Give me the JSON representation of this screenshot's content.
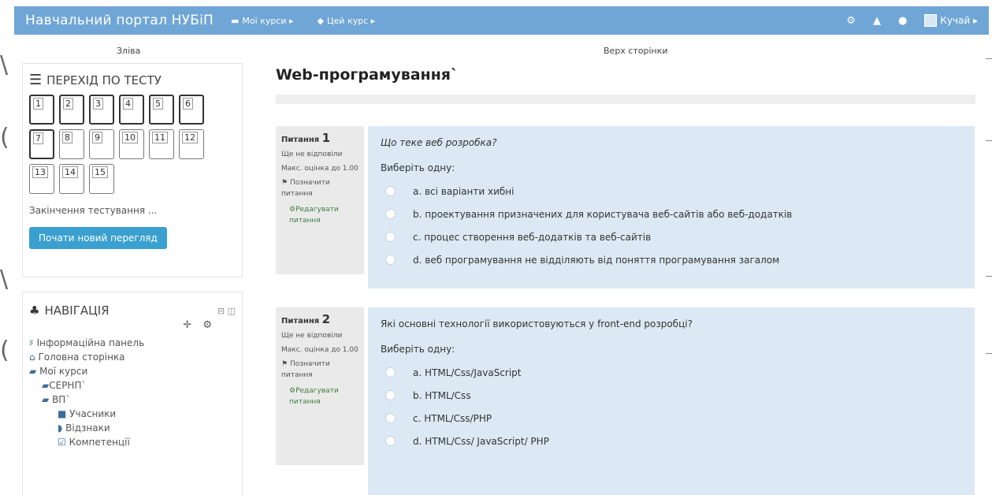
{
  "navbar": {
    "brand": "Навчальний портал НУБіП",
    "menu": [
      {
        "icon": "briefcase-icon",
        "label": "Мої курси ▸"
      },
      {
        "icon": "graduation-cap-icon",
        "label": "Цей курс ▸"
      }
    ],
    "user": "Кучай ▸"
  },
  "regions": {
    "left": "Зліва",
    "top": "Верх сторінки"
  },
  "quiz_nav": {
    "title": "ПЕРЕХІД ПО ТЕСТУ",
    "buttons": [
      "1",
      "2",
      "3",
      "4",
      "5",
      "6",
      "7",
      "8",
      "9",
      "10",
      "11",
      "12",
      "13",
      "14",
      "15"
    ],
    "finish": "Закінчення тестування ...",
    "restart": "Почати новий перегляд"
  },
  "navigation": {
    "title": "НАВІГАЦІЯ",
    "items": [
      {
        "label": "Інформаційна панель"
      },
      {
        "label": "Головна сторінка"
      },
      {
        "label": "Мої курси"
      },
      {
        "label": "СЕРНП`"
      },
      {
        "label": "ВП`"
      },
      {
        "label": "Учасники"
      },
      {
        "label": "Відзнаки"
      },
      {
        "label": "Компетенції"
      }
    ]
  },
  "page_title": "Web-програмування`",
  "questions": [
    {
      "label": "Питання",
      "number": "1",
      "status": "Ще не відповіли",
      "max_grade": "Макс. оцінка до 1.00",
      "flag": "Позначити питання",
      "edit": "Редагувати питання",
      "text": "Що теке веб розробка?",
      "prompt": "Виберіть одну:",
      "answers": [
        "a. всі варіанти хибні",
        "b. проектування призначених для користувача веб-сайтів або веб-додатків",
        "c. процес створення веб-додатків та веб-сайтів",
        "d. веб програмування не відділяють від поняття програмування загалом"
      ]
    },
    {
      "label": "Питання",
      "number": "2",
      "status": "Ще не відповіли",
      "max_grade": "Макс. оцінка до 1.00",
      "flag": "Позначити питання",
      "edit": "Редагувати питання",
      "text": "Які основні технології використовуються у front-end розробці?",
      "prompt": "Виберіть одну:",
      "answers": [
        "a. HTML/Css/JavaScript",
        "b. HTML/Css",
        "c. HTML/Css/PHP",
        "d. HTML/Css/ JavaScript/ PHP"
      ]
    }
  ],
  "colors": {
    "navbar": "#6fa6d6",
    "question_bg": "#dce9f4",
    "button": "#3aa0cf"
  }
}
